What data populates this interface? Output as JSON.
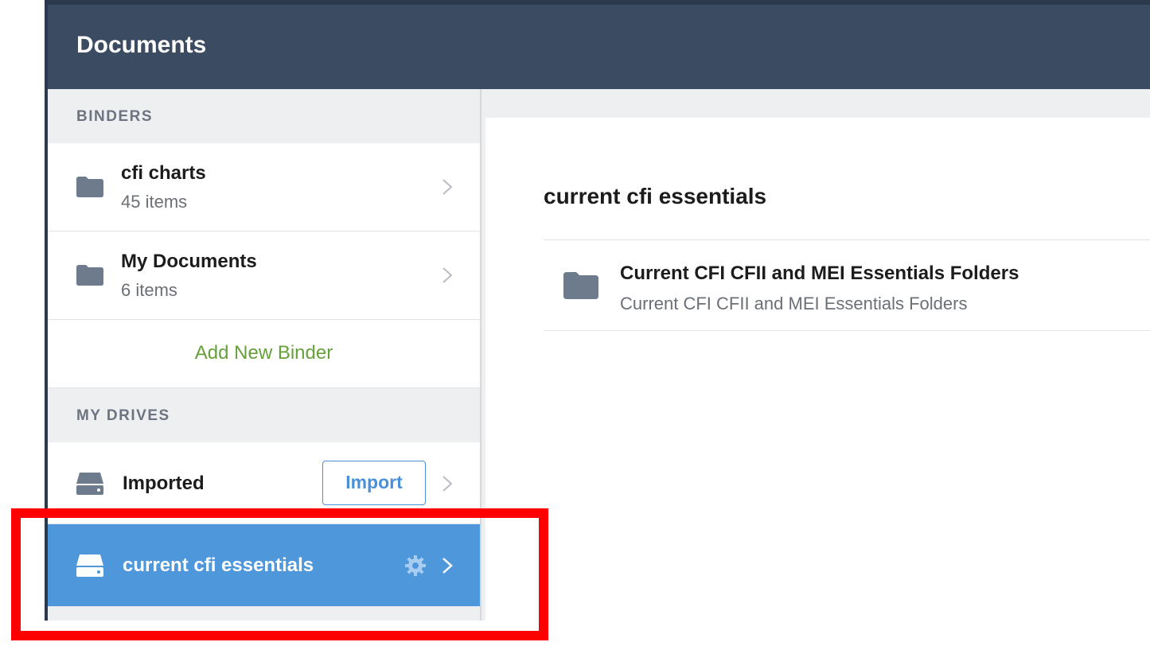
{
  "header": {
    "title": "Documents"
  },
  "sidebar": {
    "binders_header": "BINDERS",
    "binders": [
      {
        "name": "cfi charts",
        "count": "45 items"
      },
      {
        "name": "My Documents",
        "count": "6 items"
      }
    ],
    "add_binder_label": "Add New Binder",
    "drives_header": "MY DRIVES",
    "drives": [
      {
        "name": "Imported",
        "action_label": "Import"
      },
      {
        "name": "current cfi essentials",
        "selected": true
      }
    ]
  },
  "main": {
    "heading": "current cfi essentials",
    "items": [
      {
        "name": "Current CFI CFII and MEI Essentials Folders",
        "description": "Current CFI CFII and MEI Essentials Folders"
      }
    ]
  },
  "colors": {
    "topbar": "#3b4b61",
    "accent_blue": "#4f97db",
    "add_green": "#66a03a",
    "highlight_red": "#ff0000"
  },
  "icons": [
    "folder-icon",
    "chevron-right-icon",
    "drive-icon",
    "gear-icon"
  ]
}
